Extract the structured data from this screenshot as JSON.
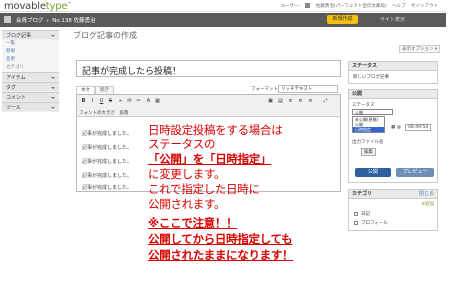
{
  "app": {
    "logo_text": "movable",
    "logo_text2": "type"
  },
  "topbar": {
    "user_label": "ユーザー:",
    "user_name": "佐藤勇治(パーフェクト宣伝文庫局)",
    "help": "ヘルプ",
    "signout": "サインアウト"
  },
  "navbar": {
    "blog_label": "会員ブログ",
    "blog_number": "No.138",
    "author": "佐藤勇治",
    "new_button": "新規作成",
    "view_site": "サイト表示"
  },
  "sidebar": {
    "items": [
      {
        "label": "ブログ記事",
        "type": "head"
      },
      {
        "label": "一覧",
        "type": "sub"
      },
      {
        "label": "新規",
        "type": "sub"
      },
      {
        "label": "変更",
        "type": "sub"
      },
      {
        "label": "カテゴリ",
        "type": "sub"
      },
      {
        "label": "アイテム",
        "type": "head"
      },
      {
        "label": "タグ",
        "type": "head"
      },
      {
        "label": "コメント",
        "type": "head"
      },
      {
        "label": "ツール",
        "type": "head"
      }
    ]
  },
  "page": {
    "title": "ブログ記事の作成",
    "display_options": "表示オプション ▾"
  },
  "entry": {
    "title_value": "記事が完成したら投稿！",
    "tab_body": "本文",
    "tab_more": "続き",
    "format_label": "フォーマット",
    "format_value": "リッチテキスト",
    "font_size_label": "フォントの大きさ",
    "font_size_value": "段落",
    "body_lines": [
      "記事が完成しました。",
      "記事が完成しました。",
      "記事が完成しました。",
      "記事が完成しました。",
      "記事が完成しました。"
    ]
  },
  "toolbar_icons": [
    "bold-icon",
    "italic-icon",
    "underline-icon",
    "strikethrough-icon",
    "link-icon",
    "email-link-icon",
    "unlink-icon"
  ],
  "status_box": {
    "title": "ステータス",
    "value": "新しいブログ記事"
  },
  "publish_box": {
    "title": "公開",
    "status_label": "ステータス",
    "status_value": "公開",
    "options": [
      "未公開(原稿)",
      "公開",
      "日時指定"
    ],
    "selected_option": "日時指定",
    "time_value": "08:49:54",
    "filename_label": "出力ファイル名",
    "edit_label": "編集",
    "publish_button": "公開",
    "preview_button": "プレビュー"
  },
  "category_box": {
    "title": "カテゴリ",
    "toggle": "閉じる",
    "add": "追加",
    "items": [
      "日記",
      "プロフィール"
    ]
  },
  "callout": {
    "line1": "日時設定投稿をする場合は",
    "line2": "ステータスの",
    "line3": "「公開」を「日時指定」",
    "line4": "に変更します。",
    "line5": "これで指定した日時に",
    "line6": "公開されます。",
    "line7": "※ここで注意！！",
    "line8": "公開してから日時指定しても",
    "line9": "公開されたままになります！"
  },
  "colors": {
    "accent_green": "#76a130",
    "callout_red": "#d80000",
    "new_button": "#f2c00d",
    "publish_blue": "#2b5f9e"
  }
}
